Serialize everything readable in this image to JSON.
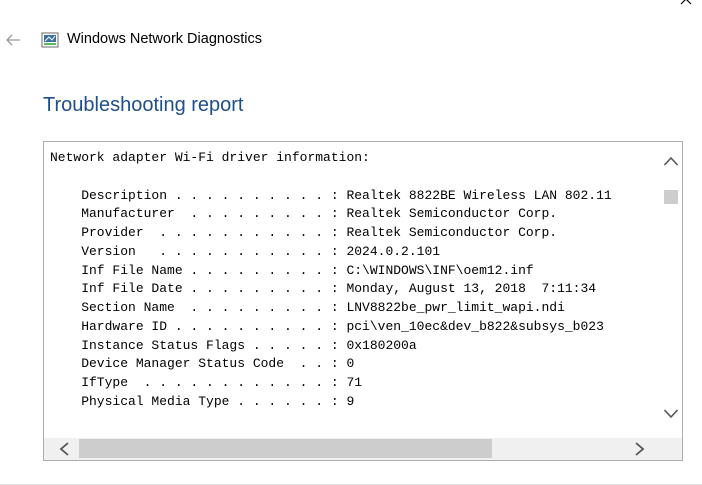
{
  "window": {
    "app_title": "Windows Network Diagnostics",
    "close_icon": "close-icon",
    "back_icon": "back-arrow-icon",
    "app_icon": "network-diagnostics-icon"
  },
  "report": {
    "heading": "Troubleshooting report",
    "lines": [
      "Network adapter Wi-Fi driver information:",
      "",
      "    Description . . . . . . . . . . : Realtek 8822BE Wireless LAN 802.11",
      "    Manufacturer  . . . . . . . . . : Realtek Semiconductor Corp.",
      "    Provider  . . . . . . . . . . . : Realtek Semiconductor Corp.",
      "    Version   . . . . . . . . . . . : 2024.0.2.101",
      "    Inf File Name . . . . . . . . . : C:\\WINDOWS\\INF\\oem12.inf",
      "    Inf File Date . . . . . . . . . : Monday, August 13, 2018  7:11:34",
      "    Section Name  . . . . . . . . . : LNV8822be_pwr_limit_wapi.ndi",
      "    Hardware ID . . . . . . . . . . : pci\\ven_10ec&dev_b822&subsys_b023",
      "    Instance Status Flags . . . . . : 0x180200a",
      "    Device Manager Status Code  . . : 0",
      "    IfType  . . . . . . . . . . . . : 71",
      "    Physical Media Type . . . . . . : 9"
    ]
  },
  "scrollbars": {
    "up_icon": "chevron-up-icon",
    "down_icon": "chevron-down-icon",
    "left_icon": "chevron-left-icon",
    "right_icon": "chevron-right-icon"
  },
  "colors": {
    "heading": "#1f4e8c",
    "border": "#adadad",
    "scroll_thumb": "#cdcdcd",
    "scroll_track": "#f0f0f0"
  }
}
